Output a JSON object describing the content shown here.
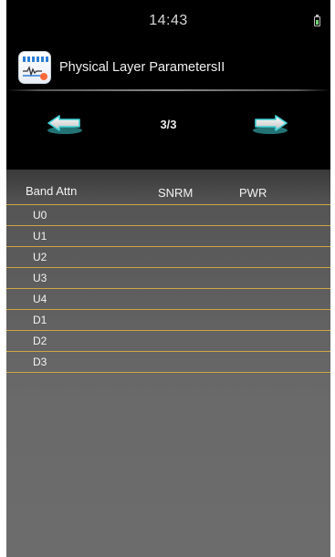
{
  "status_bar": {
    "time": "14:43",
    "battery_icon": "battery-icon"
  },
  "header": {
    "app_icon": "dsl-meter-icon",
    "title": "Physical Layer ParametersII"
  },
  "pager": {
    "prev_icon": "arrow-left-icon",
    "next_icon": "arrow-right-icon",
    "page_label": "3/3"
  },
  "table": {
    "columns": [
      "Band Attn",
      "SNRM",
      "PWR"
    ],
    "rows": [
      {
        "label": "U0"
      },
      {
        "label": "U1"
      },
      {
        "label": "U2"
      },
      {
        "label": "U3"
      },
      {
        "label": "U4"
      },
      {
        "label": "D1"
      },
      {
        "label": "D2"
      },
      {
        "label": "D3"
      }
    ]
  },
  "colors": {
    "divider": "#d0a645",
    "arrow_accent": "#3fd1d6",
    "background": "#000000"
  }
}
